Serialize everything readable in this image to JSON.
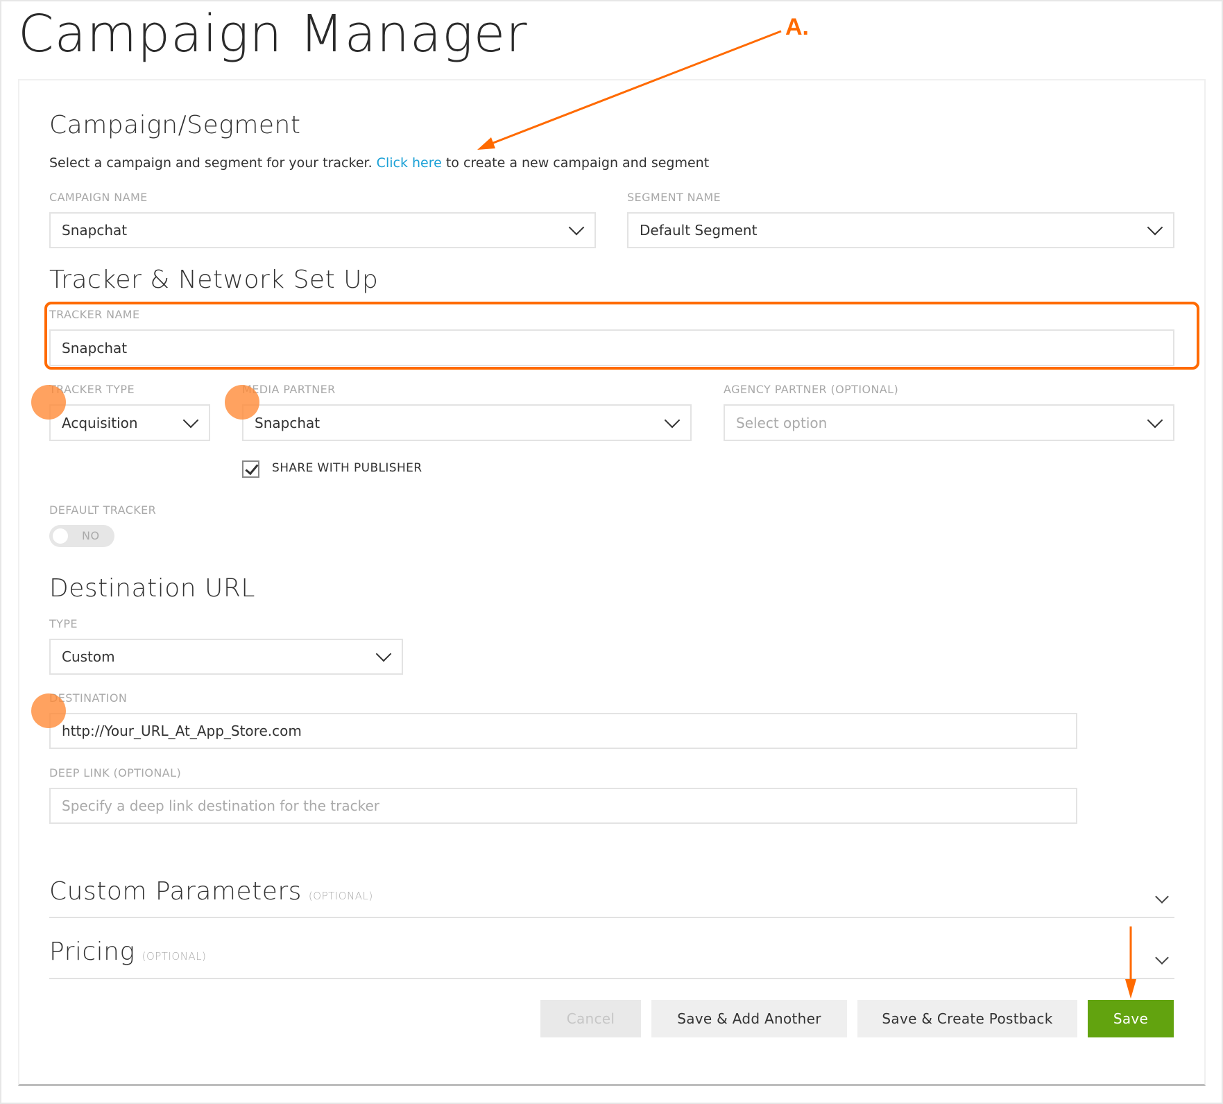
{
  "page": {
    "title": "Campaign Manager"
  },
  "annotation": {
    "label": "A.",
    "color": "#ff6a00"
  },
  "campaign_segment": {
    "heading": "Campaign/Segment",
    "description_prefix": "Select a campaign and segment for your tracker. ",
    "link_text": "Click here",
    "description_suffix": " to create a new campaign and segment",
    "campaign_name": {
      "label": "CAMPAIGN NAME",
      "value": "Snapchat"
    },
    "segment_name": {
      "label": "SEGMENT NAME",
      "value": "Default Segment"
    }
  },
  "tracker_network": {
    "heading": "Tracker & Network Set Up",
    "tracker_name": {
      "label": "TRACKER NAME",
      "value": "Snapchat"
    },
    "tracker_type": {
      "label": "TRACKER TYPE",
      "value": "Acquisition"
    },
    "media_partner": {
      "label": "MEDIA PARTNER",
      "value": "Snapchat"
    },
    "agency_partner": {
      "label": "AGENCY PARTNER (OPTIONAL)",
      "placeholder": "Select option"
    },
    "share_with_publisher": {
      "label": "SHARE WITH PUBLISHER",
      "checked": true
    },
    "default_tracker": {
      "label": "DEFAULT TRACKER",
      "state": "NO"
    }
  },
  "destination_url": {
    "heading": "Destination URL",
    "type": {
      "label": "TYPE",
      "value": "Custom"
    },
    "destination": {
      "label": "DESTINATION",
      "value": "http://Your_URL_At_App_Store.com"
    },
    "deep_link": {
      "label": "DEEP LINK (OPTIONAL)",
      "placeholder": "Specify a deep link destination for the tracker"
    }
  },
  "sections": {
    "custom_parameters": {
      "heading": "Custom Parameters",
      "optional": "(OPTIONAL)"
    },
    "pricing": {
      "heading": "Pricing",
      "optional": "(OPTIONAL)"
    }
  },
  "buttons": {
    "cancel": "Cancel",
    "save_add_another": "Save & Add Another",
    "save_create_postback": "Save & Create Postback",
    "save": "Save"
  },
  "colors": {
    "link": "#1aa0d6",
    "primary_button": "#62a30f",
    "annotation": "#ff6a00"
  }
}
